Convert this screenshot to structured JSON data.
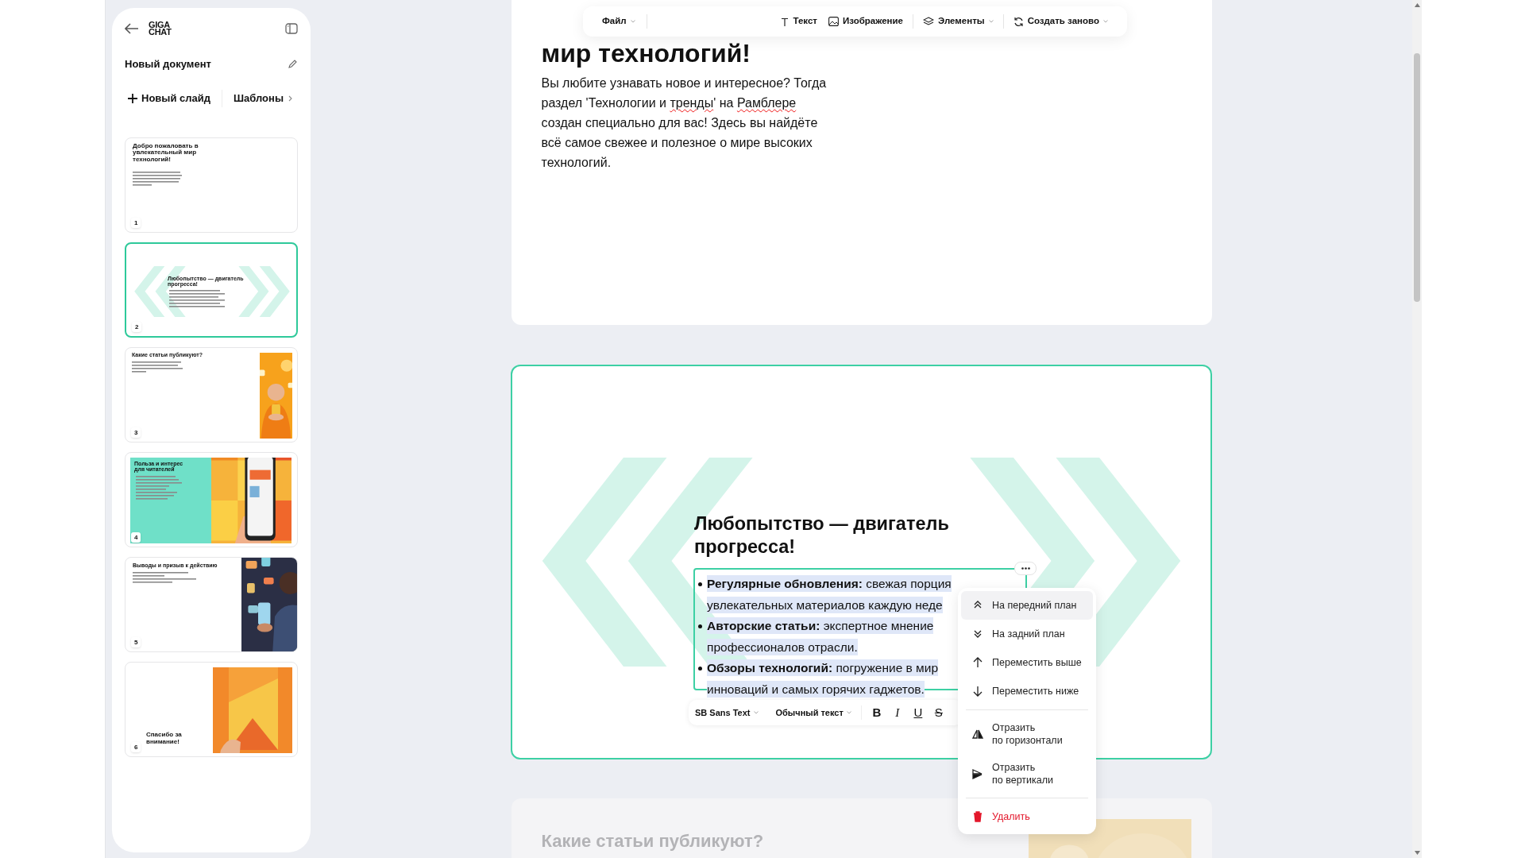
{
  "sidebar": {
    "logo_lines": [
      "GIGA",
      "CHAT"
    ],
    "document_title": "Новый документ",
    "new_slide_button": "Новый слайд",
    "templates_button": "Шаблоны",
    "slides": [
      {
        "number": "1",
        "selected": false,
        "kind": "text",
        "title": "Добро пожаловать в увлекательный мир технологий!"
      },
      {
        "number": "2",
        "selected": true,
        "kind": "chevrons",
        "title": "Любопытство — двигатель прогресса!"
      },
      {
        "number": "3",
        "selected": false,
        "kind": "image_right",
        "title": "Какие статьи публикуют?"
      },
      {
        "number": "4",
        "selected": false,
        "kind": "split",
        "title": "Польза и интерес для читателей"
      },
      {
        "number": "5",
        "selected": false,
        "kind": "image_edge",
        "title": "Выводы и призыв к действию"
      },
      {
        "number": "6",
        "selected": false,
        "kind": "closing",
        "title": "Спасибо за внимание!"
      }
    ]
  },
  "toolbar": [
    {
      "label": "Файл",
      "dropdown": true
    },
    {
      "label": "Текст",
      "dropdown": false
    },
    {
      "label": "Изображение",
      "dropdown": false
    },
    {
      "label": "Элементы",
      "dropdown": true
    },
    {
      "label": "Создать заново",
      "dropdown": true
    }
  ],
  "canvas": {
    "slide_1": {
      "title_lines": [
        "мир технологий!"
      ],
      "paragraph": [
        {
          "text": "Вы любите узнавать новое и интересное? Тогда раздел 'Технологии и ",
          "spellcheck_error": false
        },
        {
          "text": "тренды",
          "spellcheck_error": true
        },
        {
          "text": "' на ",
          "spellcheck_error": false
        },
        {
          "text": "Рамблере",
          "spellcheck_error": true
        },
        {
          "text": " создан специально для вас! Здесь вы найдёте всё самое свежее и полезное о мире высоких технологий.",
          "spellcheck_error": false
        }
      ]
    },
    "slide_2": {
      "selected": true,
      "title": "Любопытство — двигатель прогресса!",
      "bullets": [
        {
          "label": "Регулярные обновления:",
          "text": " свежая порция увлекательных материалов каждую неде"
        },
        {
          "label": "Авторские статьи:",
          "text": " экспертное мнение профессионалов отрасли."
        },
        {
          "label": "Обзоры технологий:",
          "text": " погружение в мир инноваций и самых горячих гаджетов."
        }
      ],
      "text_toolbar": {
        "font": "SB Sans Text",
        "style": "Обычный текст",
        "format_buttons": [
          "B",
          "I",
          "U",
          "S"
        ]
      },
      "context_menu": [
        {
          "label": "На передний план",
          "highlighted": true,
          "kind": "action",
          "divider_before": false
        },
        {
          "label": "На задний план",
          "highlighted": false,
          "kind": "action",
          "divider_before": false
        },
        {
          "label": "Переместить выше",
          "highlighted": false,
          "kind": "action",
          "divider_before": false
        },
        {
          "label": "Переместить ниже",
          "highlighted": false,
          "kind": "action",
          "divider_before": false
        },
        {
          "label": "Отразить\nпо горизонтали",
          "highlighted": false,
          "kind": "action",
          "divider_before": true
        },
        {
          "label": "Отразить\nпо вертикали",
          "highlighted": false,
          "kind": "action",
          "divider_before": false
        },
        {
          "label": "Удалить",
          "highlighted": false,
          "kind": "danger",
          "divider_before": true
        }
      ]
    },
    "slide_3": {
      "title": "Какие статьи публикуют?"
    }
  }
}
